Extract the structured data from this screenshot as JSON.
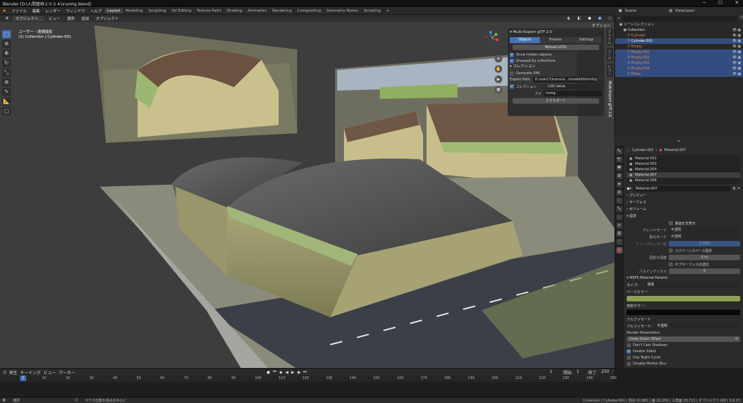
{
  "window": {
    "title": "Blender [D:\\入間基地２０２４\\irumhg.blend]"
  },
  "menu": [
    "ファイル",
    "編集",
    "レンダー",
    "ウィンドウ",
    "ヘルプ"
  ],
  "workspaces": [
    "Layout",
    "Modeling",
    "Sculpting",
    "UV Editing",
    "Texture Paint",
    "Shading",
    "Animation",
    "Rendering",
    "Compositing",
    "Geometry Nodes",
    "Scripting"
  ],
  "active_workspace": "Layout",
  "scene": "Scene",
  "view_layer": "ViewLayer",
  "toolbar": {
    "mode": "オブジェクト...",
    "items": [
      "ビュー",
      "選択",
      "追加",
      "オブジェクト"
    ],
    "options": "オプション"
  },
  "viewport_info": {
    "line1": "ユーザー・透視投影",
    "line2": "(1) Collection | Cylinder.001"
  },
  "side_tabs": [
    "アイテム",
    "ツール",
    "ビュー",
    "Multi-Export glTF 2.0"
  ],
  "panel": {
    "title": "Multi-Export glTF 2.0",
    "tabs": [
      "Objects",
      "Presets",
      "Settings"
    ],
    "reload": "Reload LODs",
    "show_hidden": "Show hidden objects",
    "grouped": "Grouped by collections",
    "collection_header": "コレクション",
    "generate_xml": "Generate XML",
    "export_path_label": "Export Path:",
    "export_path": "D:\\sdk17\\iruma-b...\\model\\lib\\irmhg",
    "collection_label": "コレクション",
    "lod_value": "LOD Value",
    "file_label": "ファ",
    "file_value": "irmhg",
    "export_btn": "エクスポート"
  },
  "outliner": {
    "header": "シーンコレクション",
    "rows": [
      {
        "name": "Collection",
        "depth": 1,
        "sel": false,
        "color": "#dddddd"
      },
      {
        "name": "Cylinder",
        "depth": 2,
        "sel": false,
        "color": "#e08a4a"
      },
      {
        "name": "Cylinder.001",
        "depth": 2,
        "sel": true,
        "color": "#ffffff"
      },
      {
        "name": "Empty",
        "depth": 2,
        "sel": false,
        "color": "#e08a4a"
      },
      {
        "name": "Empty.001",
        "depth": 2,
        "sel": true,
        "color": "#e08a4a"
      },
      {
        "name": "Empty.002",
        "depth": 2,
        "sel": true,
        "color": "#e08a4a"
      },
      {
        "name": "Empty.003",
        "depth": 2,
        "sel": true,
        "color": "#e08a4a"
      },
      {
        "name": "Empty.004",
        "depth": 2,
        "sel": true,
        "color": "#e08a4a"
      },
      {
        "name": "Plane",
        "depth": 2,
        "sel": true,
        "color": "#e08a4a"
      }
    ]
  },
  "properties": {
    "breadcrumb_obj": "Cylinder.001",
    "breadcrumb_mat": "Material.007",
    "materials": [
      "Material.002",
      "Material.003",
      "Material.004",
      "Material.007",
      "Material.008"
    ],
    "selected_material": "Material.007",
    "active_material": "Material.007",
    "sections": [
      "プレビュー",
      "サーフェス",
      "ボリューム",
      "設定"
    ],
    "settings": {
      "backface": "裏面を非表示",
      "blend_label": "ブレンドモード",
      "blend_val": "不透明",
      "shadow_label": "影のモード",
      "shadow_val": "不透明",
      "clip_label": "クリップのしきい値",
      "clip_val": "0.500",
      "screen_space": "スクリーンスペース屈折",
      "refraction_label": "屈折の深度",
      "refraction_val": "0 m",
      "subsurface": "サブサーフェスの透光",
      "pass_label": "パスインデックス",
      "pass_val": "0"
    },
    "msfs": {
      "header": "MSFS Material Params",
      "type_label": "タイプ:",
      "type_val": "標準",
      "base_color_label": "ベースカラー:",
      "base_color": "#8fa055",
      "emissive_label": "放射カラー:",
      "emissive": "#0a0a0a",
      "alpha_header": "アルファモード",
      "alpha_label": "アルファモード:",
      "alpha_val": "不透明",
      "render_params": "Render Parameters",
      "draw_order": "Draw Order Offset",
      "draw_val": "0",
      "dont_cast": "Don't Cast Shadows",
      "double_sided": "Double Sided",
      "day_night": "Day Night Cycle",
      "disable_motion": "Disable Motion Blur"
    }
  },
  "timeline": {
    "menu": [
      "再生",
      "キーイング",
      "ビュー",
      "マーカー"
    ],
    "current": "1",
    "start_label": "開始",
    "start": "1",
    "end_label": "終了",
    "end": "250",
    "ticks": [
      "10",
      "20",
      "30",
      "40",
      "50",
      "60",
      "70",
      "80",
      "90",
      "100",
      "110",
      "120",
      "130",
      "140",
      "150",
      "160",
      "170",
      "180",
      "190",
      "200",
      "210",
      "220",
      "230",
      "240",
      "250"
    ]
  },
  "status": {
    "left": "選択",
    "mid": "マウス位置を視点の中心に",
    "right": "Collection | Cylinder.001 | 頂点:10,861 | 面:10,206 | 三角面:20,711 | オブジェクト:0/8 | 3.6.23"
  },
  "colors": {
    "accent": "#4772b3",
    "selected_row": "#334d80"
  }
}
